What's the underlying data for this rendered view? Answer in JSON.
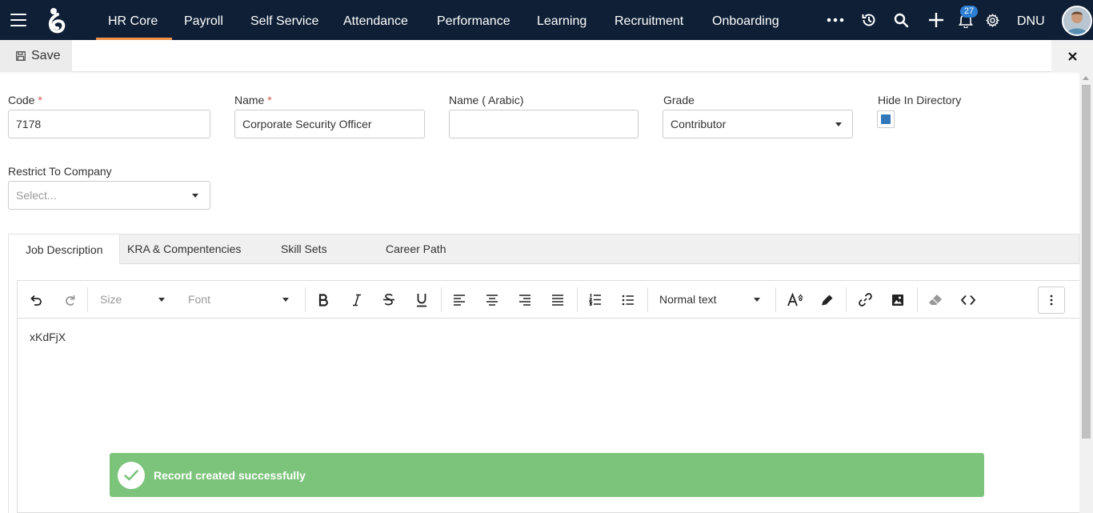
{
  "nav": {
    "tabs": [
      {
        "label": "HR Core",
        "active": true
      },
      {
        "label": "Payroll"
      },
      {
        "label": "Self Service"
      },
      {
        "label": "Attendance"
      },
      {
        "label": "Performance"
      },
      {
        "label": "Learning"
      },
      {
        "label": "Recruitment"
      },
      {
        "label": "Onboarding"
      }
    ],
    "icons": [
      "more-icon",
      "history-icon",
      "search-icon",
      "add-icon",
      "bell-icon",
      "gear-icon"
    ],
    "notification_count": "27",
    "user_initials": "DNU",
    "accent": "#f0904b",
    "background": "#0e1f36"
  },
  "actionbar": {
    "save_label": "Save",
    "close_icon": "close-icon"
  },
  "form": {
    "code": {
      "label": "Code",
      "required": "*",
      "value": "7178"
    },
    "name": {
      "label": "Name",
      "required": "*",
      "value": "Corporate Security Officer"
    },
    "name_arabic": {
      "label": "Name ( Arabic)",
      "value": ""
    },
    "grade": {
      "label": "Grade",
      "value": "Contributor"
    },
    "hide_in_directory": {
      "label": "Hide In Directory",
      "checked": true
    },
    "restrict_to_company": {
      "label": "Restrict To Company",
      "placeholder": "Select..."
    }
  },
  "tabs": [
    {
      "label": "Job Description",
      "active": true
    },
    {
      "label": "KRA & Compentencies"
    },
    {
      "label": "Skill Sets"
    },
    {
      "label": "Career Path"
    }
  ],
  "editor": {
    "size_placeholder": "Size",
    "font_placeholder": "Font",
    "paragraph_style": "Normal text",
    "content": "xKdFjX",
    "toolbar_icons": [
      "undo-icon",
      "redo-icon",
      "bold-icon",
      "italic-icon",
      "strikethrough-icon",
      "underline-icon",
      "align-left-icon",
      "align-center-icon",
      "align-right-icon",
      "align-justify-icon",
      "ordered-list-icon",
      "unordered-list-icon",
      "font-color-icon",
      "highlight-icon",
      "link-icon",
      "image-icon",
      "eraser-icon",
      "code-icon",
      "more-vertical-icon"
    ]
  },
  "toast": {
    "message": "Record created successfully",
    "color": "#7cc47b"
  }
}
